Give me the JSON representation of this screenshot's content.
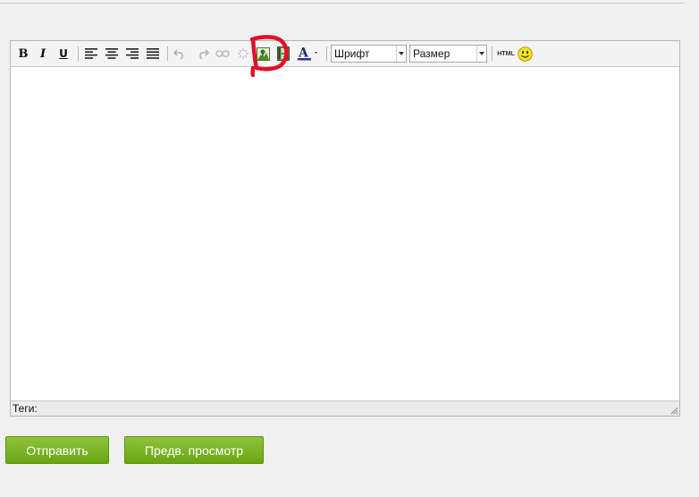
{
  "toolbar": {
    "bold_glyph": "B",
    "italic_glyph": "I",
    "underline_glyph": "U",
    "html_label": "HTML",
    "font_select": {
      "value": "Шрифт"
    },
    "size_select": {
      "value": "Размер"
    },
    "icons": [
      "bold-icon",
      "italic-icon",
      "underline-icon",
      "align-left-icon",
      "align-center-icon",
      "align-right-icon",
      "align-justify-icon",
      "undo-icon",
      "redo-icon",
      "link-icon",
      "unlink-icon",
      "insert-image-icon",
      "insert-video-icon",
      "text-color-icon",
      "html-source-icon",
      "smiley-icon"
    ]
  },
  "editor": {
    "content": "",
    "tags_label": "Теги:"
  },
  "buttons": {
    "submit": "Отправить",
    "preview": "Предв. просмотр"
  },
  "annotation": {
    "color": "#e0102a",
    "target": "insert-image-icon"
  },
  "colors": {
    "button_green": "#79b323",
    "text_color_bar": "#333399"
  }
}
